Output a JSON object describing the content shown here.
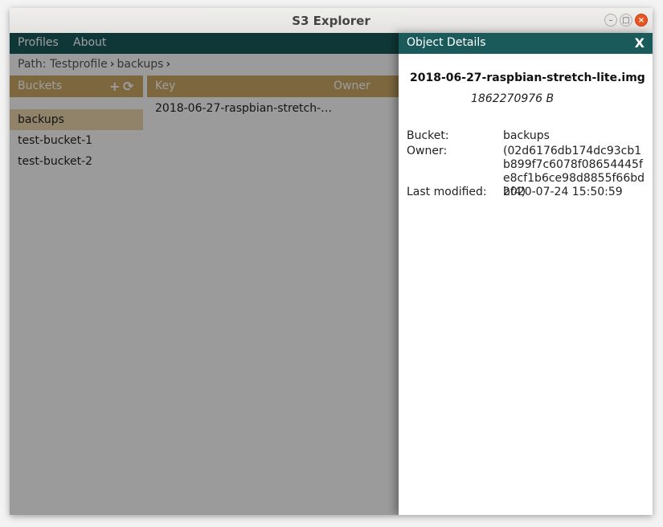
{
  "window": {
    "title": "S3 Explorer"
  },
  "menu": {
    "profiles": "Profiles",
    "about": "About"
  },
  "path": {
    "prefix": "Path:",
    "segments": [
      "Testprofile",
      "backups"
    ]
  },
  "buckets": {
    "header": "Buckets",
    "items": [
      {
        "label": "backups",
        "selected": true
      },
      {
        "label": "test-bucket-1",
        "selected": false
      },
      {
        "label": "test-bucket-2",
        "selected": false
      }
    ]
  },
  "objects": {
    "columns": [
      "Key",
      "Owner"
    ],
    "rows": [
      {
        "key": "2018-06-27-raspbian-stretch-…"
      }
    ]
  },
  "details": {
    "title": "Object Details",
    "close_label": "X",
    "file_name": "2018-06-27-raspbian-stretch-lite.img",
    "size": "1862270976 B",
    "fields": [
      {
        "label": "Bucket:",
        "value": "backups"
      },
      {
        "label": "Owner:",
        "value": "(02d6176db174dc93cb1b899f7c6078f08654445fe8cf1b6ce98d8855f66bdbf4)"
      },
      {
        "label": "Last modified:",
        "value": "2020-07-24 15:50:59"
      }
    ]
  },
  "colors": {
    "accent": "#1b5a5a",
    "header_gold": "#c9a766",
    "selected": "#e8d4ac",
    "close": "#e95420"
  }
}
